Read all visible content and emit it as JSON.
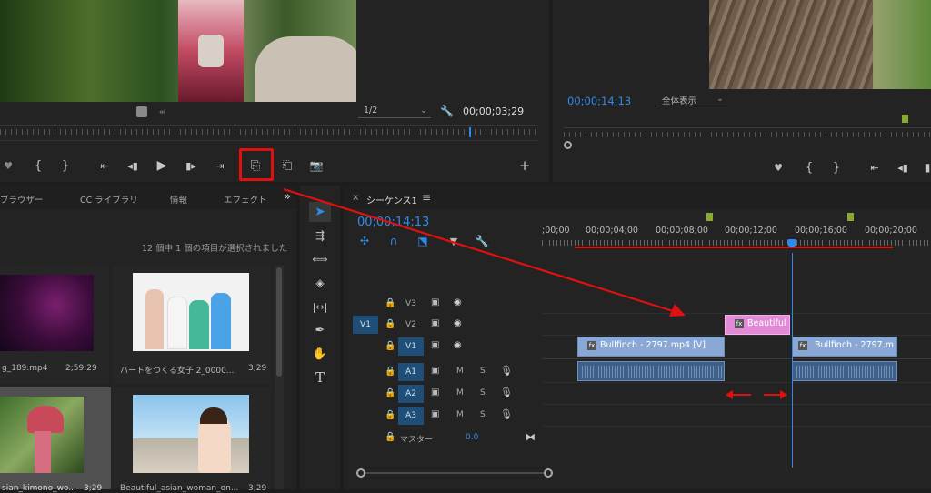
{
  "source_monitor": {
    "zoom": "1/2",
    "timecode": "00;00;03;29",
    "buttons": [
      "marker",
      "in",
      "out",
      "go-in",
      "step-back",
      "play",
      "step-fwd",
      "go-out",
      "insert",
      "overwrite",
      "export-frame",
      "add"
    ]
  },
  "program_monitor": {
    "timecode": "00;00;14;13",
    "fit": "全体表示"
  },
  "project_panel": {
    "tabs": [
      "ブラウザー",
      "CC ライブラリ",
      "情報",
      "エフェクト"
    ],
    "more": "»",
    "status": "12 個中 1 個の項目が選択されました",
    "items": [
      {
        "name": "g_189.mp4",
        "duration": "2;59;29"
      },
      {
        "name": "ハートをつくる女子 2_0000...",
        "duration": "3;29"
      },
      {
        "name": "sian_kimono_wo...",
        "duration": "3;29"
      },
      {
        "name": "Beautiful_asian_woman_on...",
        "duration": "3;29"
      }
    ]
  },
  "timeline": {
    "close": "×",
    "title": "シーケンス1",
    "menu": "≡",
    "timecode": "00;00;14;13",
    "ruler": [
      ";00;00",
      "00;00;04;00",
      "00;00;08;00",
      "00;00;12;00",
      "00;00;16;00",
      "00;00;20;00"
    ],
    "tracks": {
      "v3": "V3",
      "v2": "V2",
      "v1": "V1",
      "src_v1": "V1",
      "a1": "A1",
      "a2": "A2",
      "a3": "A3",
      "m": "M",
      "s": "S",
      "master": "マスター",
      "master_val": "0.0"
    },
    "clips": {
      "beautiful": "Beautiful",
      "bullfinch1": "Bullfinch - 2797.mp4 [V]",
      "bullfinch2": "Bullfinch - 2797.m"
    }
  },
  "colors": {
    "accent": "#2d8ceb",
    "annotation": "#e01010",
    "clip_video": "#89a8d6",
    "clip_graphic": "#e28ad6",
    "clip_audio": "#3d5f8a"
  }
}
